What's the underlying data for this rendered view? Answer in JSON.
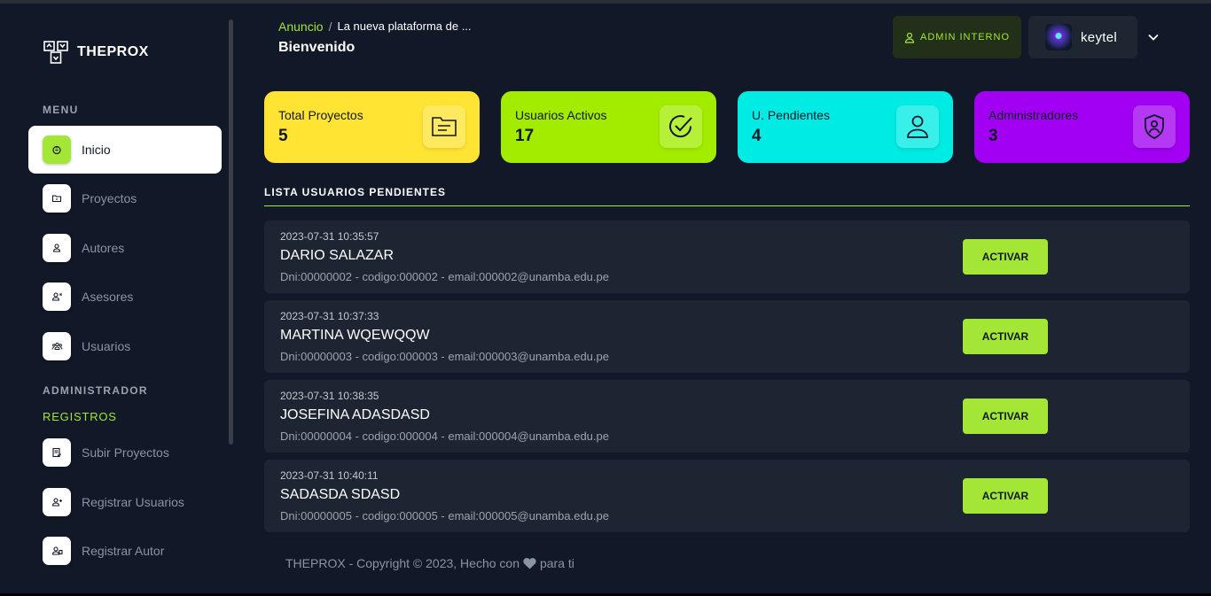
{
  "brand": {
    "name": "THEPROX"
  },
  "sidebar": {
    "menu_heading": "MENU",
    "admin_heading": "ADMINISTRADOR",
    "registros_heading": "REGISTROS",
    "items": [
      {
        "label": "Inicio",
        "icon": "home-icon",
        "active": true
      },
      {
        "label": "Proyectos",
        "icon": "folder-icon"
      },
      {
        "label": "Autores",
        "icon": "user-icon"
      },
      {
        "label": "Asesores",
        "icon": "advisor-icon"
      },
      {
        "label": "Usuarios",
        "icon": "users-icon"
      },
      {
        "label": "Subir Proyectos",
        "icon": "upload-doc-icon"
      },
      {
        "label": "Registrar Usuarios",
        "icon": "user-plus-icon"
      },
      {
        "label": "Registrar Autor",
        "icon": "author-add-icon"
      }
    ]
  },
  "header": {
    "breadcrumb_link": "Anuncio",
    "breadcrumb_sep": "/",
    "breadcrumb_current": "La nueva plataforma de ...",
    "title": "Bienvenido",
    "role_badge": "ADMIN INTERNO",
    "username": "keytel"
  },
  "stats": [
    {
      "label": "Total Proyectos",
      "value": "5",
      "color": "#ffe433",
      "icon": "document-icon"
    },
    {
      "label": "Usuarios Activos",
      "value": "17",
      "color": "#a3ec00",
      "icon": "check-circle-icon"
    },
    {
      "label": "U. Pendientes",
      "value": "4",
      "color": "#00ebe3",
      "icon": "user-icon"
    },
    {
      "label": "Administradores",
      "value": "3",
      "color": "#a100f2",
      "icon": "shield-user-icon"
    }
  ],
  "pending": {
    "title": "LISTA USUARIOS PENDIENTES",
    "button_label": "ACTIVAR",
    "rows": [
      {
        "date": "2023-07-31 10:35:57",
        "name": "DARIO SALAZAR",
        "info": "Dni:00000002 - codigo:000002 - email:000002@unamba.edu.pe"
      },
      {
        "date": "2023-07-31 10:37:33",
        "name": "MARTINA WQEWQQW",
        "info": "Dni:00000003 - codigo:000003 - email:000003@unamba.edu.pe"
      },
      {
        "date": "2023-07-31 10:38:35",
        "name": "JOSEFINA ADASDASD",
        "info": "Dni:00000004 - codigo:000004 - email:000004@unamba.edu.pe"
      },
      {
        "date": "2023-07-31 10:40:11",
        "name": "SADASDA SDASD",
        "info": "Dni:00000005 - codigo:000005 - email:000005@unamba.edu.pe"
      }
    ]
  },
  "footer": {
    "before": "THEPROX - Copyright © 2023, Hecho con",
    "after": "para ti"
  },
  "theme": {
    "accent": "#a3e635",
    "background": "#111827",
    "row_bg": "#1e2532"
  }
}
